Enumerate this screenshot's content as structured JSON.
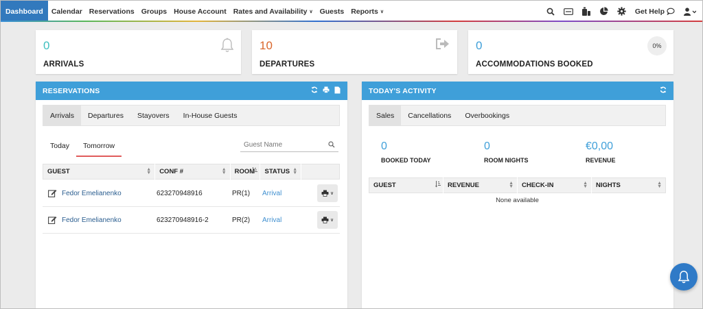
{
  "nav": {
    "items": [
      {
        "label": "Dashboard",
        "active": true
      },
      {
        "label": "Calendar"
      },
      {
        "label": "Reservations"
      },
      {
        "label": "Groups"
      },
      {
        "label": "House Account"
      },
      {
        "label": "Rates and Availability",
        "dropdown": true
      },
      {
        "label": "Guests"
      },
      {
        "label": "Reports",
        "dropdown": true
      }
    ],
    "help_label": "Get Help",
    "icons": [
      "search-icon",
      "card-icon",
      "devices-icon",
      "pie-chart-icon",
      "gear-icon",
      "user-icon"
    ]
  },
  "cards": {
    "arrivals": {
      "value": "0",
      "label": "ARRIVALS",
      "color": "#3fbfbf"
    },
    "departures": {
      "value": "10",
      "label": "DEPARTURES",
      "color": "#d9662b"
    },
    "accommodations": {
      "value": "0",
      "label": "ACCOMMODATIONS BOOKED",
      "percent": "0%",
      "color": "#3f9fd9"
    }
  },
  "reservations": {
    "title": "RESERVATIONS",
    "tabs": [
      "Arrivals",
      "Departures",
      "Stayovers",
      "In-House Guests"
    ],
    "active_tab": "Arrivals",
    "subtabs": [
      "Today",
      "Tomorrow"
    ],
    "active_subtab": "Tomorrow",
    "search_placeholder": "Guest Name",
    "columns": [
      "GUEST",
      "CONF #",
      "ROOM",
      "STATUS"
    ],
    "rows": [
      {
        "guest": "Fedor Emelianenko",
        "conf": "623270948916",
        "room": "PR(1)",
        "status": "Arrival"
      },
      {
        "guest": "Fedor Emelianenko",
        "conf": "623270948916-2",
        "room": "PR(2)",
        "status": "Arrival"
      }
    ]
  },
  "activity": {
    "title": "TODAY'S ACTIVITY",
    "tabs": [
      "Sales",
      "Cancellations",
      "Overbookings"
    ],
    "active_tab": "Sales",
    "stats": [
      {
        "value": "0",
        "label": "BOOKED TODAY"
      },
      {
        "value": "0",
        "label": "ROOM NIGHTS"
      },
      {
        "value": "€0,00",
        "label": "REVENUE"
      }
    ],
    "columns": [
      "GUEST",
      "REVENUE",
      "CHECK-IN",
      "NIGHTS"
    ],
    "empty_text": "None available"
  },
  "colors": {
    "header_blue": "#3f9fd9",
    "nav_active": "#3279bd",
    "link": "#2a5d8f",
    "status_link": "#3f8fd0",
    "tab_underline": "#e05a5a"
  }
}
